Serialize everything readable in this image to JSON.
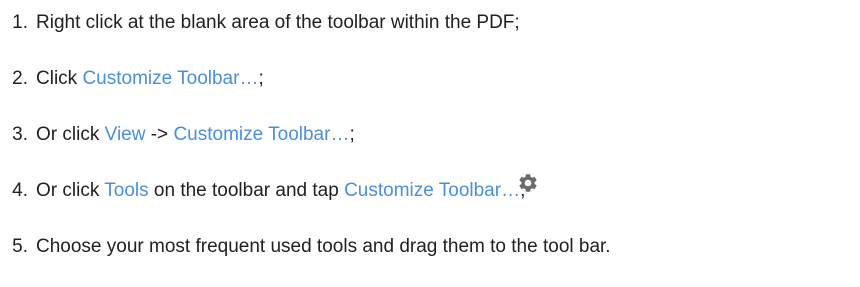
{
  "steps": [
    {
      "number": "1.",
      "text": "Right click at the blank area of the toolbar within the PDF;"
    },
    {
      "number": "2.",
      "prefix": "Click ",
      "link": "Customize Toolbar…",
      "suffix": ";"
    },
    {
      "number": "3.",
      "prefix": "Or click ",
      "link1": "View",
      "middle": " -> ",
      "link2": "Customize Toolbar…",
      "suffix": ";"
    },
    {
      "number": "4.",
      "prefix": "Or click ",
      "link1": "Tools",
      "middle": " on the toolbar and tap ",
      "link2": "Customize Toolbar…",
      "suffix": ";",
      "icon": "gear-icon"
    },
    {
      "number": "5.",
      "text": "Choose your most frequent used tools and drag them to the tool bar."
    }
  ],
  "colors": {
    "link": "#4a90d9",
    "text": "#202124",
    "icon": "#6b6b6b"
  }
}
